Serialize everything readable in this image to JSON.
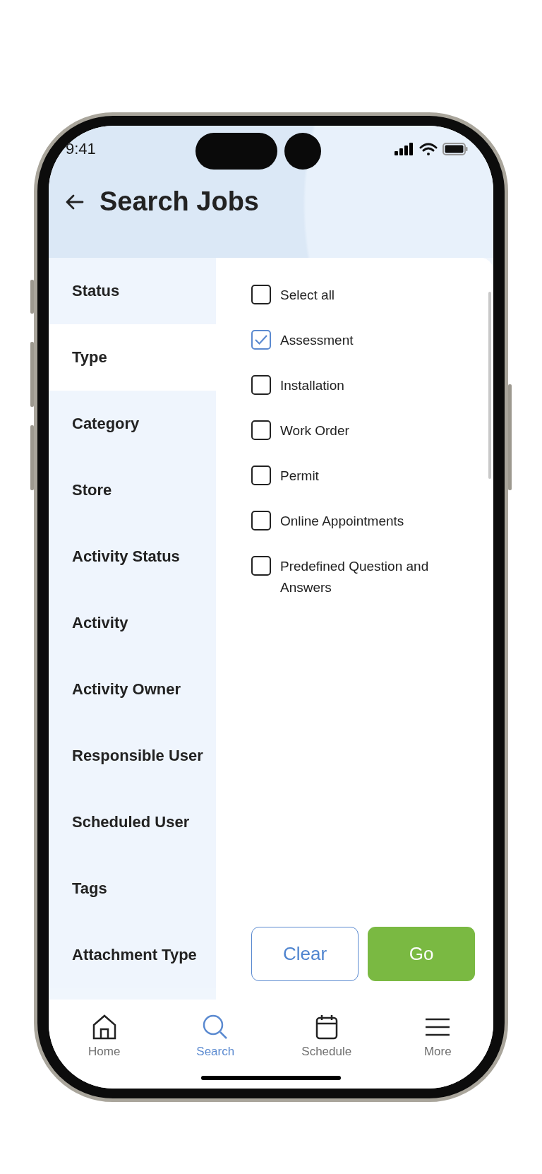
{
  "status_bar": {
    "time": "9:41"
  },
  "header": {
    "title": "Search Jobs"
  },
  "filter_categories": [
    {
      "label": "Status",
      "selected": false
    },
    {
      "label": "Type",
      "selected": true
    },
    {
      "label": "Category",
      "selected": false
    },
    {
      "label": "Store",
      "selected": false
    },
    {
      "label": "Activity Status",
      "selected": false
    },
    {
      "label": "Activity",
      "selected": false
    },
    {
      "label": "Activity Owner",
      "selected": false
    },
    {
      "label": "Responsible User",
      "selected": false
    },
    {
      "label": "Scheduled User",
      "selected": false
    },
    {
      "label": "Tags",
      "selected": false
    },
    {
      "label": "Attachment Type",
      "selected": false
    }
  ],
  "options": [
    {
      "label": "Select all",
      "checked": false
    },
    {
      "label": "Assessment",
      "checked": true
    },
    {
      "label": "Installation",
      "checked": false
    },
    {
      "label": "Work Order",
      "checked": false
    },
    {
      "label": "Permit",
      "checked": false
    },
    {
      "label": "Online Appointments",
      "checked": false
    },
    {
      "label": "Predefined Question and Answers",
      "checked": false
    }
  ],
  "buttons": {
    "clear": "Clear",
    "go": "Go"
  },
  "nav": [
    {
      "label": "Home",
      "kind": "home",
      "selected": false
    },
    {
      "label": "Search",
      "kind": "search",
      "selected": true
    },
    {
      "label": "Schedule",
      "kind": "schedule",
      "selected": false
    },
    {
      "label": "More",
      "kind": "more",
      "selected": false
    }
  ]
}
